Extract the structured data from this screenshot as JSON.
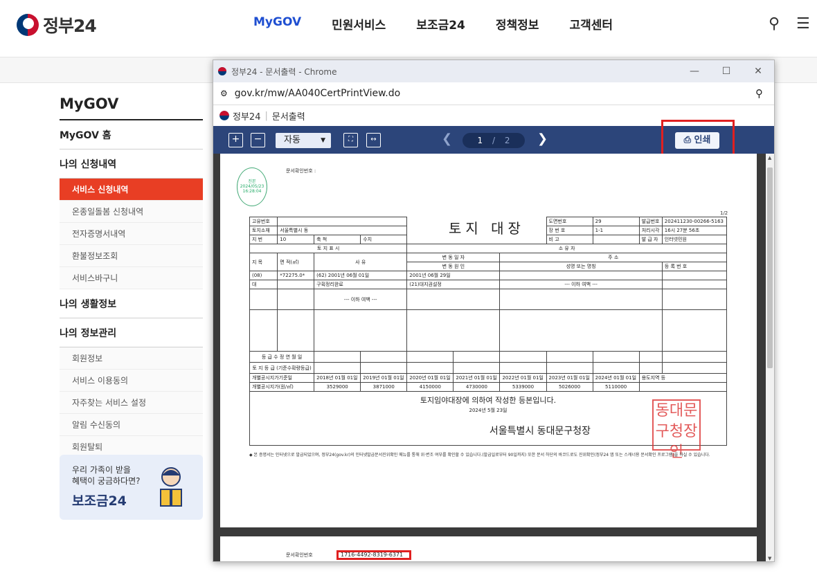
{
  "header": {
    "logo_text": "정부24",
    "nav": [
      "MyGOV",
      "민원서비스",
      "보조금24",
      "정책정보",
      "고객센터"
    ]
  },
  "sidebar": {
    "title": "MyGOV",
    "items": [
      {
        "label": "MyGOV 홈",
        "level": 1
      },
      {
        "label": "나의 신청내역",
        "level": 1
      },
      {
        "label": "서비스 신청내역",
        "level": 2,
        "active": true
      },
      {
        "label": "온종일돌봄 신청내역",
        "level": 2
      },
      {
        "label": "전자증명서내역",
        "level": 2
      },
      {
        "label": "환불정보조회",
        "level": 2
      },
      {
        "label": "서비스바구니",
        "level": 2
      },
      {
        "label": "나의 생활정보",
        "level": 1
      },
      {
        "label": "나의 정보관리",
        "level": 1
      },
      {
        "label": "회원정보",
        "level": 2
      },
      {
        "label": "서비스 이용동의",
        "level": 2
      },
      {
        "label": "자주찾는 서비스 설정",
        "level": 2
      },
      {
        "label": "알림 수신동의",
        "level": 2
      },
      {
        "label": "회원탈퇴",
        "level": 2
      }
    ],
    "promo": {
      "line1": "우리 가족이 받을",
      "line2": "혜택이 궁금하다면?",
      "title": "보조금24"
    }
  },
  "popup": {
    "window_title": "정부24 - 문서출력 - Chrome",
    "url": "gov.kr/mw/AA040CertPrintView.do",
    "page_header": {
      "site": "정부24",
      "page": "문서출력"
    },
    "toolbar": {
      "zoom_mode": "자동",
      "page_current": "1",
      "page_total": "2",
      "print_label": "인쇄"
    }
  },
  "document": {
    "confirm_label": "문서확인번호 :",
    "page_indicator": "1/2",
    "title": "토지 대장",
    "stamp": {
      "l1": "진본",
      "l2": "2024/05/23",
      "l3": "16:28:04"
    },
    "meta": {
      "unique_no_label": "고유번호",
      "land_loc_label": "토지소재",
      "land_loc": "서울특별시 동",
      "lot_label": "지 번",
      "lot": "10",
      "scale_label": "축 척",
      "scale": "수치",
      "map_no_label": "도면번호",
      "map_no": "29",
      "sheet_label": "장 번 호",
      "sheet": "1-1",
      "note_label": "비 고",
      "issue_no_label": "발급번호",
      "issue_no": "202411230-00266-5163",
      "time_label": "처리시각",
      "time": "16시 27분 56초",
      "issuer_label": "발 급 자",
      "issuer": "인터넷민원"
    },
    "land_section": "토 지 표 시",
    "owner_section": "소 유 자",
    "cols": {
      "category": "지 목",
      "area": "면 적(㎡)",
      "reason": "사 유",
      "change_date": "변 동 일 자",
      "change_cause": "변 동 원 인",
      "address": "주 소",
      "name": "성명 또는 명칭",
      "reg_no": "등 록 번 호"
    },
    "row1": {
      "category": "(08)",
      "area": "*72275.0*",
      "reason": "(62) 2001년 06월 01일",
      "change_date": "2001년 06월 29일"
    },
    "row2": {
      "category": "대",
      "reason": "구획정리완료",
      "change_cause": "(21)대지권설정"
    },
    "blank_mark": "--- 이하 여백 ---",
    "grade_label": "등 급 수 정 연 월 일",
    "grade2_label": "토 지 등 급 (기준수확량등급)",
    "price_date_label": "개별공시지가기준일",
    "price_label": "개별공시지가(원/㎡)",
    "price_dates": [
      "2018년 01월 01일",
      "2019년 01월 01일",
      "2020년 01월 01일",
      "2021년 01월 01일",
      "2022년 01월 01일",
      "2023년 01월 01일",
      "2024년 01월 01일"
    ],
    "prices": [
      "3529000",
      "3871000",
      "4150000",
      "4730000",
      "5339000",
      "5026000",
      "5110000"
    ],
    "price_use_label": "용도지역 등",
    "certify": "토지임야대장에 의하여 작성한 등본입니다.",
    "certify_date": "2024년 5월 23일",
    "office": "서울특별시 동대문구청장",
    "seal_text": "동대문 구청장인",
    "footnote": "◆ 본 증명서는 인터넷으로 발급되었으며, 정부24(gov.kr)의 인터넷발급문서진위확인 메뉴를 통해 위·변조 여부를 확인할 수 있습니다.(발급일로부터 90일까지) 또한 문서 하단의 바코드로도 진위확인(정부24 앱 또는 스캐너용 문서확인 프로그램)을 하실 수 있습니다.",
    "page2_confirm_label": "문서확인번호",
    "page2_confirm_no": "1716-4492-8319-6371"
  }
}
